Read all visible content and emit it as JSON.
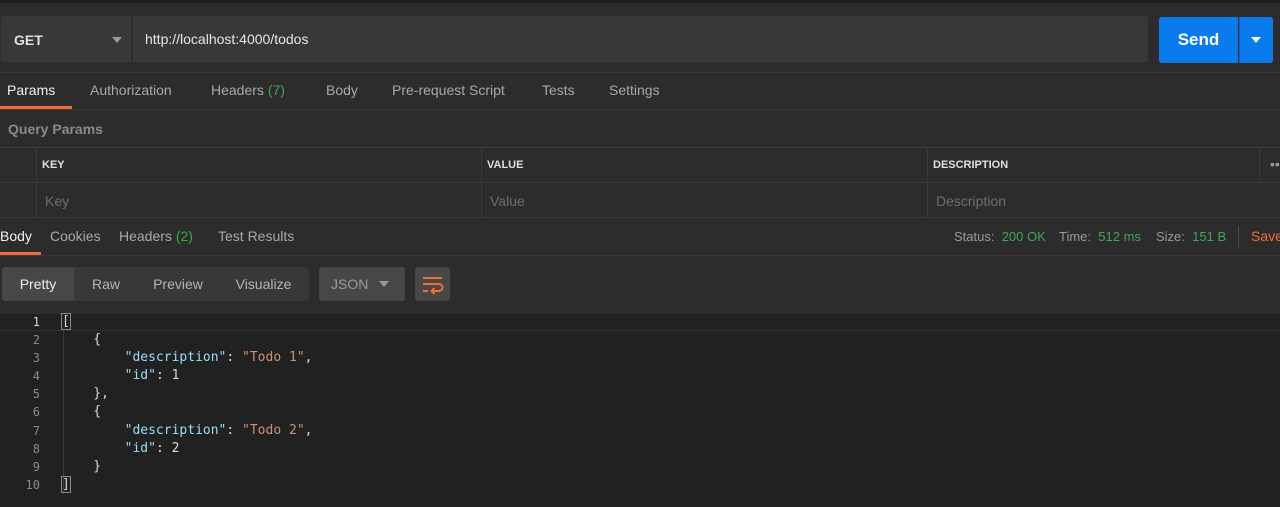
{
  "request": {
    "method": "GET",
    "url": "http://localhost:4000/todos",
    "send_label": "Send"
  },
  "request_tabs": [
    {
      "label": "Params"
    },
    {
      "label": "Authorization"
    },
    {
      "label": "Headers",
      "count": "(7)"
    },
    {
      "label": "Body"
    },
    {
      "label": "Pre-request Script"
    },
    {
      "label": "Tests"
    },
    {
      "label": "Settings"
    }
  ],
  "query_params": {
    "title": "Query Params",
    "columns": [
      "KEY",
      "VALUE",
      "DESCRIPTION"
    ],
    "placeholders": [
      "Key",
      "Value",
      "Description"
    ],
    "more": "••"
  },
  "response_tabs": [
    {
      "label": "Body"
    },
    {
      "label": "Cookies"
    },
    {
      "label": "Headers",
      "count": "(2)"
    },
    {
      "label": "Test Results"
    }
  ],
  "response_stats": {
    "status_label": "Status:",
    "status_value": "200 OK",
    "time_label": "Time:",
    "time_value": "512 ms",
    "size_label": "Size:",
    "size_value": "151 B",
    "save_label": "Save"
  },
  "view_modes": [
    "Pretty",
    "Raw",
    "Preview",
    "Visualize"
  ],
  "format": "JSON",
  "code_lines": [
    {
      "num": "1",
      "text": "["
    },
    {
      "num": "2",
      "text": "    {"
    },
    {
      "num": "3",
      "text": "        \"description\": \"Todo 1\","
    },
    {
      "num": "4",
      "text": "        \"id\": 1"
    },
    {
      "num": "5",
      "text": "    },"
    },
    {
      "num": "6",
      "text": "    {"
    },
    {
      "num": "7",
      "text": "        \"description\": \"Todo 2\","
    },
    {
      "num": "8",
      "text": "        \"id\": 2"
    },
    {
      "num": "9",
      "text": "    }"
    },
    {
      "num": "10",
      "text": "]"
    }
  ],
  "colors": {
    "accent": "#f26b3a",
    "send": "#097bed",
    "success": "#3ea852",
    "json_key": "#9cdcfe",
    "json_string": "#ce9178"
  }
}
